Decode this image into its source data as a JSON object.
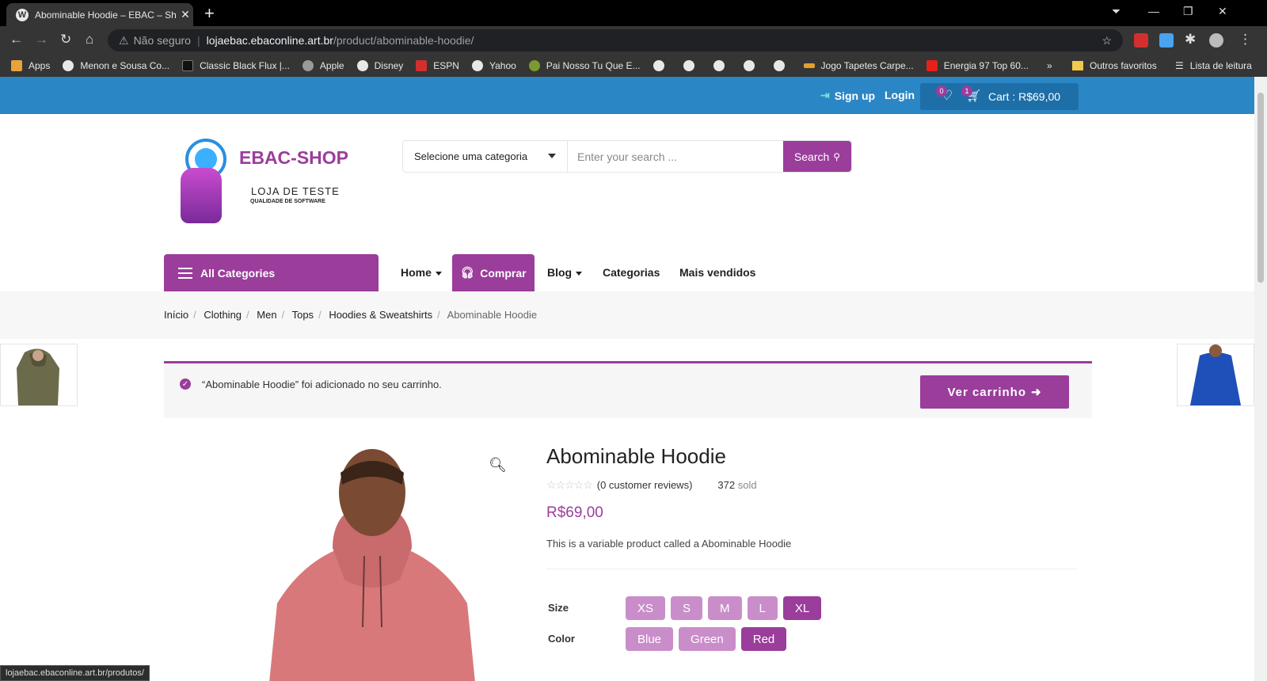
{
  "browser": {
    "tab_title": "Abominable Hoodie – EBAC – Sh",
    "security_label": "Não seguro",
    "url_host": "lojaebac.ebaconline.art.br",
    "url_path": "/product/abominable-hoodie/",
    "bookmarks": [
      "Apps",
      "Menon e Sousa Co...",
      "Classic Black Flux |...",
      "Apple",
      "Disney",
      "ESPN",
      "Yahoo",
      "Pai Nosso Tu Que E...",
      "Jogo Tapetes Carpe...",
      "Energia 97 Top 60..."
    ],
    "bookmark_more": "»",
    "other_favorites": "Outros favoritos",
    "reading_list": "Lista de leitura",
    "status_url": "lojaebac.ebaconline.art.br/produtos/"
  },
  "topbar": {
    "signup": "Sign up",
    "login": "Login",
    "wishlist_count": "0",
    "cart_count": "1",
    "cart_label": "Cart : R$69,00"
  },
  "logo": {
    "name": "EBAC-SHOP",
    "sub1": "LOJA DE TESTE",
    "sub2": "QUALIDADE DE SOFTWARE"
  },
  "search": {
    "category": "Selecione uma categoria",
    "placeholder": "Enter your search ...",
    "button": "Search"
  },
  "menu": {
    "all_categories": "All Categories",
    "home": "Home",
    "comprar": "Comprar",
    "blog": "Blog",
    "categorias": "Categorias",
    "mais_vendidos": "Mais vendidos"
  },
  "breadcrumb": [
    "Início",
    "Clothing",
    "Men",
    "Tops",
    "Hoodies & Sweatshirts",
    "Abominable Hoodie"
  ],
  "notice": {
    "message": "“Abominable Hoodie” foi adicionado no seu carrinho.",
    "button": "Ver carrinho"
  },
  "product": {
    "title": "Abominable Hoodie",
    "reviews": "(0 customer reviews)",
    "sold_count": "372",
    "sold_label": "sold",
    "price": "R$69,00",
    "description": "This is a variable product called a Abominable Hoodie",
    "size_label": "Size",
    "sizes": [
      "XS",
      "S",
      "M",
      "L",
      "XL"
    ],
    "selected_size": "XL",
    "color_label": "Color",
    "colors": [
      "Blue",
      "Green",
      "Red"
    ],
    "selected_color": "Red"
  },
  "colors": {
    "accent": "#9b3d9b",
    "topbar": "#2b86c5"
  }
}
